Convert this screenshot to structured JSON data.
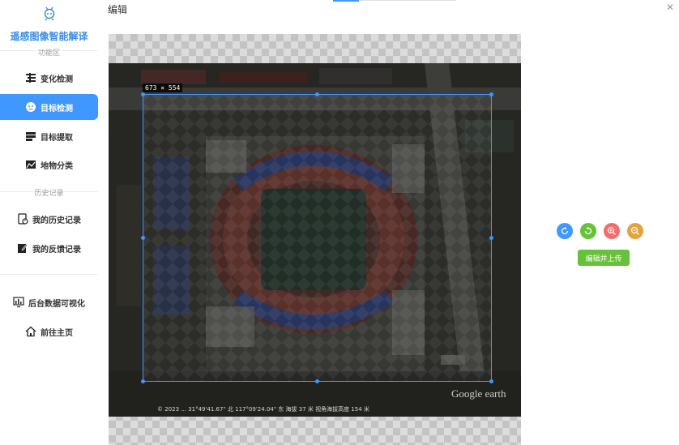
{
  "app": {
    "title": "遥感图像智能解译",
    "logo_icon": "robot-logo-icon"
  },
  "sidebar": {
    "group_functions": "功能区",
    "group_history": "历史记录",
    "items": [
      {
        "label": "变化检测",
        "icon": "change-detection-icon"
      },
      {
        "label": "目标检测",
        "icon": "target-detection-icon",
        "active": true
      },
      {
        "label": "目标提取",
        "icon": "target-extract-icon"
      },
      {
        "label": "地物分类",
        "icon": "land-classify-icon"
      },
      {
        "label": "我的历史记录",
        "icon": "history-icon"
      },
      {
        "label": "我的反馈记录",
        "icon": "feedback-icon"
      },
      {
        "label": "后台数据可视化",
        "icon": "dashboard-icon"
      },
      {
        "label": "前往主页",
        "icon": "home-icon"
      }
    ]
  },
  "modal": {
    "title": "编辑",
    "close_icon": "close-icon",
    "crop_size": "673 × 554",
    "status_text": "© 2023 ... 31°49'41.67\" 北 117°09'24.04\" 东  海拔  37 米  视角海拔高度  154 米",
    "watermark": "Google earth"
  },
  "actions": {
    "rotate_right": "rotate-right-icon",
    "rotate_left": "rotate-left-icon",
    "zoom_in": "zoom-in-icon",
    "zoom_out": "zoom-out-icon",
    "upload_label": "编辑并上传"
  },
  "colors": {
    "accent": "#3f97ff",
    "rotate_left": "#67c23a",
    "zoom_in": "#f56c6c",
    "zoom_out": "#e6a23c",
    "upload": "#67c23a"
  }
}
